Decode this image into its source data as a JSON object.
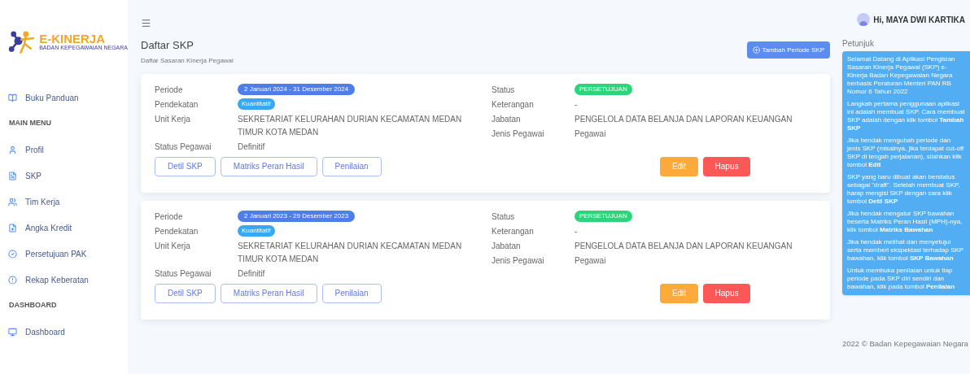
{
  "sidebar": {
    "logo": {
      "title": "E-KINERJA",
      "subtitle": "BADAN KEPEGAWAIAN NEGARA"
    },
    "items": [
      {
        "kind": "link",
        "label": "Buku Panduan"
      },
      {
        "kind": "heading",
        "label": "MAIN MENU"
      },
      {
        "kind": "link",
        "label": "Profil"
      },
      {
        "kind": "link",
        "label": "SKP"
      },
      {
        "kind": "link",
        "label": "Tim Kerja"
      },
      {
        "kind": "link",
        "label": "Angka Kredit"
      },
      {
        "kind": "link",
        "label": "Persetujuan PAK"
      },
      {
        "kind": "link",
        "label": "Rekap Keberatan"
      },
      {
        "kind": "heading",
        "label": "DASHBOARD"
      },
      {
        "kind": "link",
        "label": "Dashboard"
      }
    ]
  },
  "header": {
    "user": "Hi, MAYA DWI KARTIKA"
  },
  "page": {
    "title": "Daftar SKP",
    "subtitle": "Daftar Sasaran Kinerja Pegawai",
    "add_button": "Tambah Periode SKP"
  },
  "cards": [
    {
      "periode_label": "Periode",
      "periode": "2 Januari 2024 - 31 Desember 2024",
      "pendekatan_label": "Pendekatan",
      "pendekatan": "Kuantitatif",
      "unit_label": "Unit Kerja",
      "unit": "SEKRETARIAT KELURAHAN DURIAN KECAMATAN MEDAN TIMUR KOTA MEDAN",
      "status_pegawai_label": "Status Pegawai",
      "status_pegawai": "Definitif",
      "status_label": "Status",
      "status": "PERSETUJUAN",
      "keterangan_label": "Keterangan",
      "keterangan": "-",
      "jabatan_label": "Jabatan",
      "jabatan": "PENGELOLA DATA BELANJA DAN LAPORAN KEUANGAN",
      "jenis_label": "Jenis Pegawai",
      "jenis": "Pegawai",
      "buttons": [
        "Detil SKP",
        "Matriks Peran Hasil",
        "Penilaian"
      ],
      "edit": "Edit",
      "delete": "Hapus"
    },
    {
      "periode_label": "Periode",
      "periode": "2 Januari 2023 - 29 Desember 2023",
      "pendekatan_label": "Pendekatan",
      "pendekatan": "Kuantitatif",
      "unit_label": "Unit Kerja",
      "unit": "SEKRETARIAT KELURAHAN DURIAN KECAMATAN MEDAN TIMUR KOTA MEDAN",
      "status_pegawai_label": "Status Pegawai",
      "status_pegawai": "Definitif",
      "status_label": "Status",
      "status": "PERSETUJUAN",
      "keterangan_label": "Keterangan",
      "keterangan": "-",
      "jabatan_label": "Jabatan",
      "jabatan": "PENGELOLA DATA BELANJA DAN LAPORAN KEUANGAN",
      "jenis_label": "Jenis Pegawai",
      "jenis": "Pegawai",
      "buttons": [
        "Detil SKP",
        "Matriks Peran Hasil",
        "Penilaian"
      ],
      "edit": "Edit",
      "delete": "Hapus"
    }
  ],
  "help": {
    "title": "Petunjuk",
    "paragraphs": [
      "Selamat Datang di Aplikasi Pengisian Sasaran Kinerja Pegawai (SKP) e-Kinerja Badan Kepegawaian Negara berbasis Peraturan Menteri PAN RB Nomor 6 Tahun 2022",
      "Langkah pertama penggunaan aplikasi ini adalah membuat SKP. Cara membuat SKP adalah dengan klik tombol **Tambah SKP**",
      "Jika hendak mengubah periode dan jenis SKP (misalnya, jika terdapat cut-off SKP di tengah perjalanan), silahkan klik tombol **Edit**",
      "SKP yang baru dibuat akan berstatus sebagai \"draft\". Setelah membuat SKP, harap mengisi SKP dengan cara klik tombol **Detil SKP**",
      "Jika hendak mengatur SKP bawahan beserta Matriks Peran Hasil (MPH)-nya, klik tombol **Matriks Bawahan**",
      "Jika hendak melihat dan menyetujui serta memberi ekspektasi terhadap SKP bawahan, klik tombol **SKP Bawahan**",
      "Untuk membuka penilaian untuk tiap periode pada SKP diri sendiri dan bawahan, klik pada tombol **Penilaian**"
    ]
  },
  "footer": "2022 © Badan Kepegawaian Negara"
}
